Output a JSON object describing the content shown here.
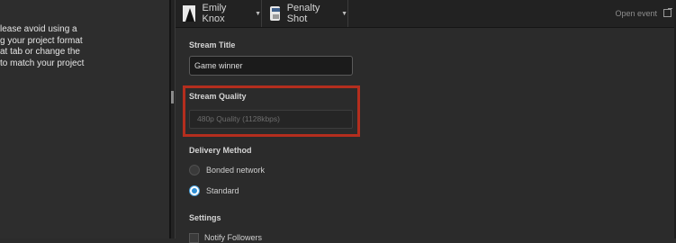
{
  "left_panel": {
    "lines": [
      "lease avoid using a",
      "g your project format",
      "at tab or change the",
      "to match your project"
    ]
  },
  "topbar": {
    "user_name": "Emily Knox",
    "event_name": "Penalty Shot",
    "open_event_label": "Open event"
  },
  "form": {
    "stream_title_label": "Stream Title",
    "stream_title_value": "Game winner",
    "stream_quality_label": "Stream Quality",
    "stream_quality_value": "480p Quality (1128kbps)",
    "delivery_method_label": "Delivery Method",
    "delivery_options": [
      {
        "label": "Bonded network",
        "selected": false
      },
      {
        "label": "Standard",
        "selected": true
      }
    ],
    "settings_label": "Settings",
    "notify_followers_label": "Notify Followers"
  },
  "colors": {
    "highlight": "#b42e1e",
    "radio_selected": "#2e8fd6"
  }
}
